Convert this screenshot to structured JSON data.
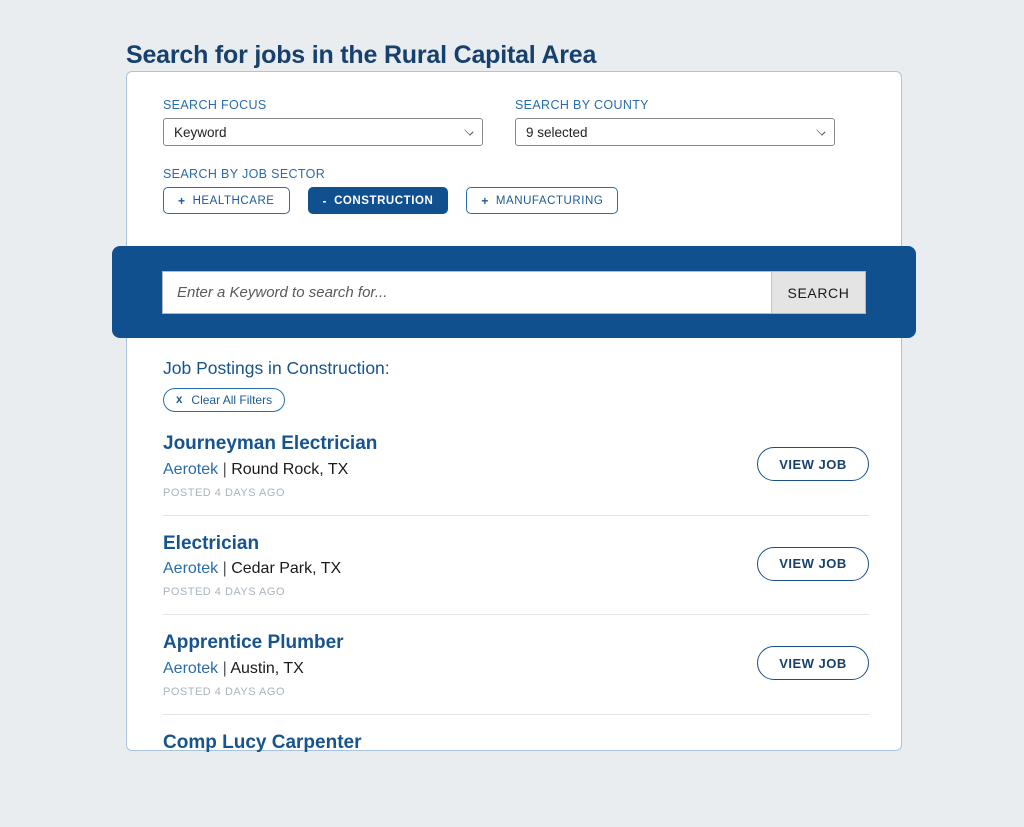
{
  "page": {
    "title": "Search for jobs in the Rural Capital Area"
  },
  "filters": {
    "focus": {
      "label": "SEARCH FOCUS",
      "value": "Keyword"
    },
    "county": {
      "label": "SEARCH BY COUNTY",
      "value": "9 selected"
    },
    "sector": {
      "label": "SEARCH BY JOB SECTOR",
      "buttons": [
        {
          "sign": "+",
          "label": "HEALTHCARE",
          "active": false
        },
        {
          "sign": "-",
          "label": "CONSTRUCTION",
          "active": true
        },
        {
          "sign": "+",
          "label": "MANUFACTURING",
          "active": false
        }
      ]
    }
  },
  "search": {
    "placeholder": "Enter a Keyword to search for...",
    "value": "",
    "button_label": "SEARCH"
  },
  "results": {
    "heading": "Job Postings in Construction:",
    "clear_filters": {
      "x": "x",
      "label": "Clear All Filters"
    },
    "view_job_label": "VIEW JOB",
    "jobs": [
      {
        "title": "Journeyman Electrician",
        "company": "Aerotek",
        "separator": "|",
        "location": "Round Rock, TX",
        "posted": "POSTED 4 DAYS AGO"
      },
      {
        "title": "Electrician",
        "company": "Aerotek",
        "separator": "|",
        "location": "Cedar Park, TX",
        "posted": "POSTED 4 DAYS AGO"
      },
      {
        "title": "Apprentice Plumber",
        "company": "Aerotek",
        "separator": "|",
        "location": "Austin, TX",
        "posted": "POSTED 4 DAYS AGO"
      },
      {
        "title": "Comp Lucy Carpenter",
        "company": "",
        "separator": "",
        "location": "",
        "posted": ""
      }
    ]
  },
  "colors": {
    "brand_blue": "#10508f",
    "link_blue": "#2a6cab",
    "heading_blue": "#17406d",
    "page_bg": "#e9edf0"
  }
}
